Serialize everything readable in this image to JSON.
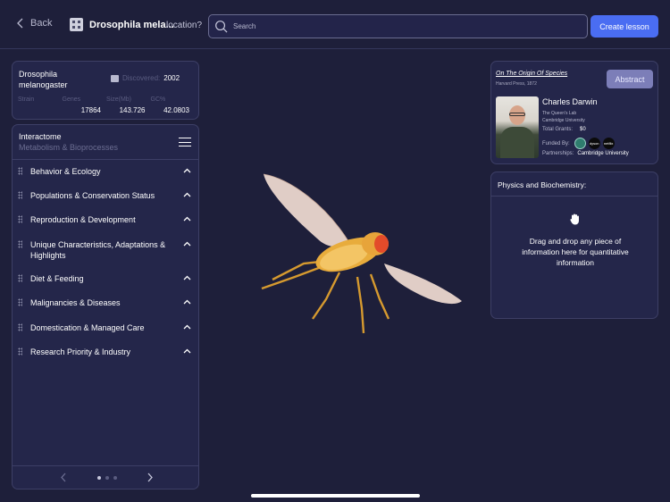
{
  "header": {
    "back_label": "Back",
    "species_title": "Drosophila mela...",
    "location_label": "location?",
    "search_placeholder": "Search",
    "create_button": "Create lesson"
  },
  "species_info": {
    "name": "Drosophila melanogaster",
    "discovered_label": "Discovered:",
    "discovered_value": "2002",
    "stats": [
      {
        "label": "Strain",
        "value": ""
      },
      {
        "label": "Genes",
        "value": "17864"
      },
      {
        "label": "Size(Mb)",
        "value": "143.726"
      },
      {
        "label": "GC%",
        "value": "42.0803"
      }
    ]
  },
  "category_list": {
    "title": "Interactome",
    "subtitle": "Metabolism & Bioprocesses",
    "items": [
      "Behavior & Ecology",
      "Populations & Conservation Status",
      "Reproduction & Development",
      "Unique Characteristics, Adaptations & Highlights",
      "Diet & Feeding",
      "Malignancies & Diseases",
      "Domestication & Managed Care",
      "Research Priority & Industry"
    ],
    "pager": {
      "pages": 3,
      "current": 1
    }
  },
  "paper": {
    "title": "On The Origin Of Species",
    "publisher": "Harvard Press, 1872",
    "abstract_button": "Abstract",
    "author": "Charles Darwin",
    "lab": "The Queen's Lab",
    "university": "Cambridge University",
    "grants_label": "Total Grants:",
    "grants_value": "$0",
    "funded_label": "Funded By:",
    "funders": [
      "",
      "dyson",
      "netflix"
    ],
    "partnerships_label": "Partnerships:",
    "partnerships_value": "Cambridge University"
  },
  "physics": {
    "title": "Physics and Biochemistry:",
    "drop_text": "Drag and drop any piece of information here for quantitative information",
    "icon": "hand-icon"
  },
  "colors": {
    "background": "#1e1f3a",
    "panel": "#24264a",
    "accent": "#4a6df2",
    "abstract_button": "#7c7eb8"
  }
}
